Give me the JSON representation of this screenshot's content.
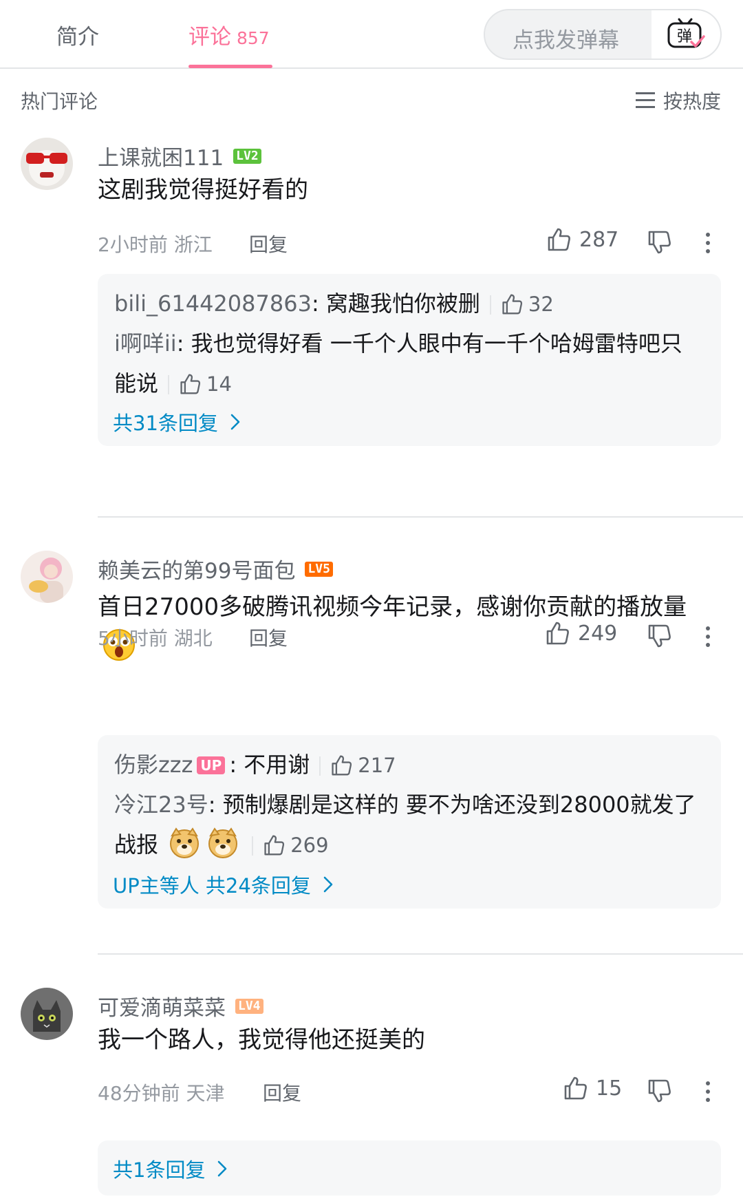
{
  "tabs": {
    "intro_label": "简介",
    "comments_label": "评论",
    "comments_count": "857"
  },
  "danmaku": {
    "placeholder": "点我发弹幕",
    "button_glyph": "弹"
  },
  "list_header": {
    "title": "热门评论",
    "sort_label": "按热度"
  },
  "comments": [
    {
      "username": "上课就困111",
      "level": "LV2",
      "level_color": "#5cc23c",
      "text": "这剧我觉得挺好看的",
      "time": "2小时前",
      "location": "浙江",
      "reply_label": "回复",
      "likes": "287",
      "replies": [
        {
          "name": "bili_61442087863",
          "text": "窝趣我怕你被删",
          "likes": "32"
        },
        {
          "name": "i啊咩ii",
          "text": "我也觉得好看 一千个人眼中有一千个哈姆雷特吧只能说",
          "likes": "14"
        }
      ],
      "more_replies": "共31条回复"
    },
    {
      "username": "赖美云的第99号面包",
      "level": "LV5",
      "level_color": "#ff6c00",
      "text": "首日27000多破腾讯视频今年记录，感谢你贡献的播放量",
      "time": "5小时前",
      "location": "湖北",
      "reply_label": "回复",
      "likes": "249",
      "replies": [
        {
          "name": "伤影zzz",
          "badge": "UP",
          "text": "不用谢",
          "likes": "217"
        },
        {
          "name": "冷江23号",
          "text": "预制爆剧是这样的 要不为啥还没到28000就发了战报",
          "likes": "269"
        }
      ],
      "more_replies": "UP主等人 共24条回复"
    },
    {
      "username": "可爱滴萌菜菜",
      "level": "LV4",
      "level_color": "#ffb27f",
      "text": "我一个路人，我觉得他还挺美的",
      "time": "48分钟前",
      "location": "天津",
      "reply_label": "回复",
      "likes": "15",
      "more_replies": "共1条回复"
    }
  ],
  "colors": {
    "accent": "#fb7299",
    "link": "#008ac5",
    "muted": "#9499a0"
  }
}
